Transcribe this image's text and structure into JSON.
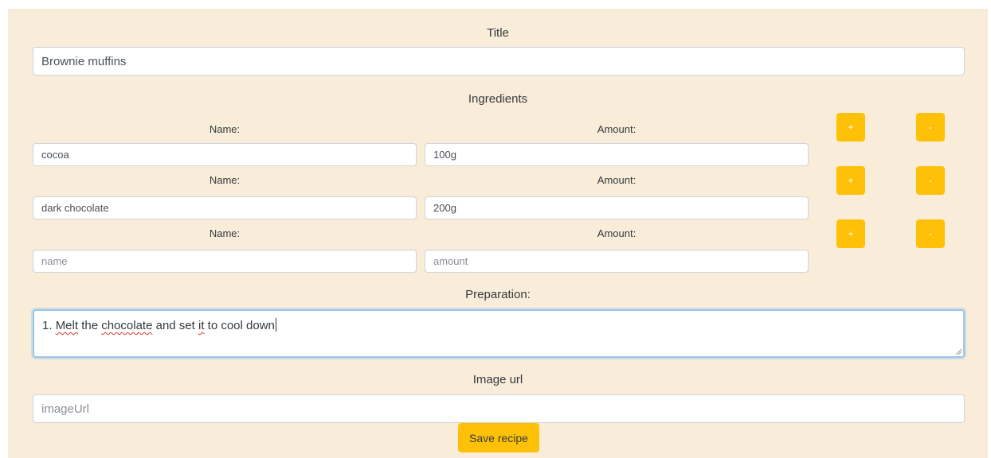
{
  "form": {
    "title_label": "Title",
    "title_value": "Brownie muffins",
    "ingredients_label": "Ingredients",
    "name_label": "Name:",
    "amount_label": "Amount:",
    "add_label": "+",
    "remove_label": "-",
    "ingredients": [
      {
        "name": "cocoa",
        "amount": "100g",
        "name_placeholder": "",
        "amount_placeholder": ""
      },
      {
        "name": "dark chocolate",
        "amount": "200g",
        "name_placeholder": "",
        "amount_placeholder": ""
      },
      {
        "name": "",
        "amount": "",
        "name_placeholder": "name",
        "amount_placeholder": "amount"
      }
    ],
    "preparation_label": "Preparation:",
    "preparation_parts": [
      "1. ",
      "Melt",
      " the ",
      "chocolate",
      " and set ",
      "it",
      " to cool down"
    ],
    "image_label": "Image url",
    "image_placeholder": "imageUrl",
    "save_label": "Save recipe"
  },
  "colors": {
    "background": "#f9ecd9",
    "accent": "#ffc107",
    "focus_border": "#9bc7e6"
  }
}
